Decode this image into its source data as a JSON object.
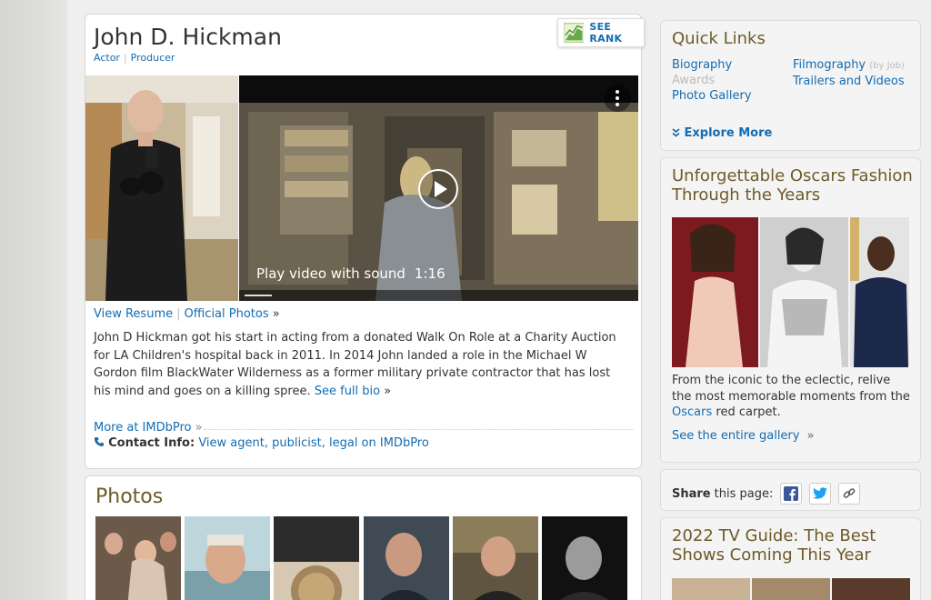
{
  "person": {
    "name": "John D. Hickman",
    "roles": [
      "Actor",
      "Producer"
    ]
  },
  "rank_button": {
    "label": "SEE RANK"
  },
  "video": {
    "caption": "Play video with sound",
    "duration": "1:16"
  },
  "links_row": {
    "resume": "View Resume",
    "photos": "Official Photos",
    "arrow": "»"
  },
  "bio": {
    "text": "John D Hickman got his start in acting from a donated Walk On Role at a Charity Auction for LA Children's hospital back in 2011. In 2014 John landed a role in the Michael W Gordon film BlackWater Wilderness as a former military private contractor that has lost his mind and goes on a killing spree.",
    "see_full": "See full bio",
    "arrow": "»"
  },
  "imdbpro": {
    "more": "More at IMDbPro",
    "arrow": "»",
    "contact_label": "Contact Info:",
    "contact_link": "View agent, publicist, legal on IMDbPro"
  },
  "photos_section": {
    "title": "Photos"
  },
  "quick_links": {
    "title": "Quick Links",
    "biography": "Biography",
    "awards": "Awards",
    "photo_gallery": "Photo Gallery",
    "filmography": "Filmography",
    "by_job": "(by Job)",
    "trailers": "Trailers and Videos",
    "explore": "Explore More"
  },
  "oscars": {
    "title": "Unforgettable Oscars Fashion Through the Years",
    "desc_before": "From the iconic to the eclectic, relive the most memorable moments from the",
    "desc_link": "Oscars",
    "desc_after": "red carpet.",
    "gallery_link": "See the entire gallery",
    "arrow": "»"
  },
  "share": {
    "label": "Share",
    "suffix": "this page:",
    "icons": [
      "facebook-icon",
      "twitter-icon",
      "link-icon"
    ]
  },
  "tv_guide": {
    "title": "2022 TV Guide: The Best Shows Coming This Year"
  },
  "colors": {
    "link": "#136cb2",
    "heading": "#6e5a28",
    "card_bg": "#ffffff",
    "rail_bg": "#f4f4f4"
  }
}
